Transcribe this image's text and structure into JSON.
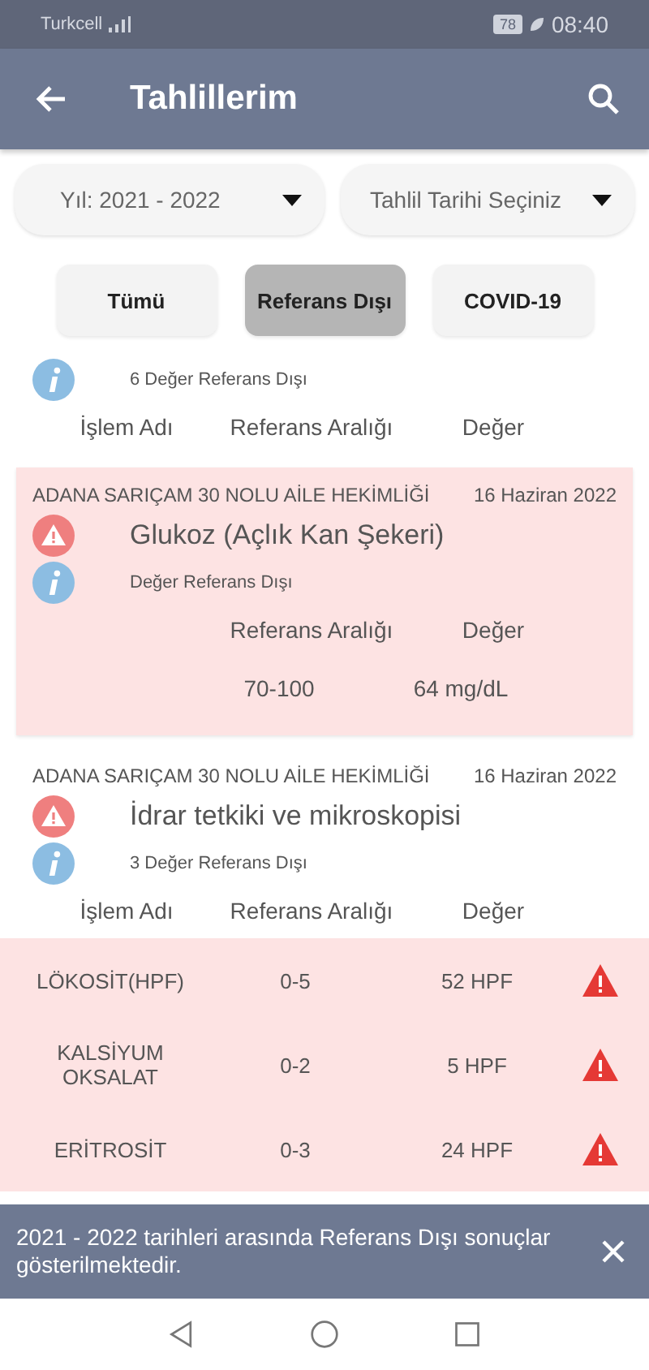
{
  "status_bar": {
    "carrier": "Turkcell",
    "battery": "78",
    "time": "08:40"
  },
  "app_bar": {
    "title": "Tahlillerim"
  },
  "dropdowns": [
    {
      "label": "Yıl: 2021 - 2022"
    },
    {
      "label": "Tahlil Tarihi Seçiniz"
    }
  ],
  "tabs": [
    {
      "label": "Tümü",
      "selected": false
    },
    {
      "label": "Referans Dışı",
      "selected": true
    },
    {
      "label": "COVID-19",
      "selected": false
    }
  ],
  "results": [
    {
      "out_of_range": false,
      "info": "6 Değer Referans Dışı",
      "columns": {
        "name": "İşlem Adı",
        "range": "Referans Aralığı",
        "value": "Değer"
      }
    },
    {
      "out_of_range": true,
      "clinic": "ADANA SARIÇAM 30 NOLU AİLE HEKİMLİĞİ",
      "date": "16 Haziran 2022",
      "title": "Glukoz (Açlık Kan Şekeri)",
      "info": "Değer Referans Dışı",
      "columns": {
        "range": "Referans Aralığı",
        "value": "Değer"
      },
      "rows": [
        {
          "range": "70-100",
          "value": "64 mg/dL",
          "flagged": false
        }
      ]
    },
    {
      "out_of_range": false,
      "clinic": "ADANA SARIÇAM 30 NOLU AİLE HEKİMLİĞİ",
      "date": "16 Haziran 2022",
      "title": "İdrar tetkiki ve mikroskopisi",
      "info": "3 Değer Referans Dışı",
      "columns": {
        "name": "İşlem Adı",
        "range": "Referans Aralığı",
        "value": "Değer"
      },
      "rows": [
        {
          "name": "LÖKOSİT(HPF)",
          "range": "0-5",
          "value": "52 HPF",
          "flagged": true
        },
        {
          "name": "KALSİYUM OKSALAT",
          "range": "0-2",
          "value": "5 HPF",
          "flagged": true
        },
        {
          "name": "ERİTROSİT",
          "range": "0-3",
          "value": "24 HPF",
          "flagged": true
        }
      ]
    }
  ],
  "snackbar": {
    "message": "2021 - 2022 tarihleri arasında Referans Dışı sonuçlar gösterilmektedir."
  }
}
